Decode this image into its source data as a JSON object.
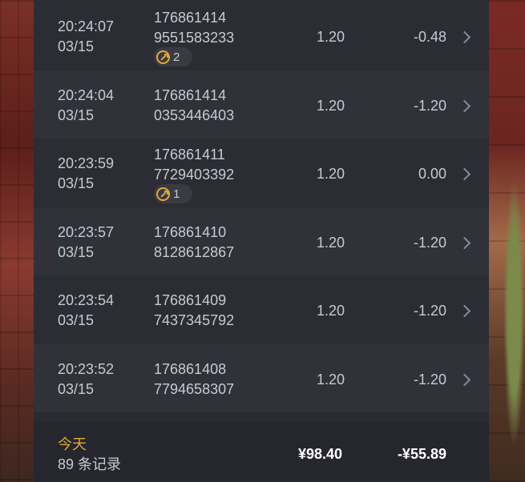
{
  "records": [
    {
      "time": "20:24:07",
      "date": "03/15",
      "order_line1": "176861414",
      "order_line2": "9551583233",
      "badge": "2",
      "amount": "1.20",
      "profit": "-0.48"
    },
    {
      "time": "20:24:04",
      "date": "03/15",
      "order_line1": "176861414",
      "order_line2": "0353446403",
      "badge": null,
      "amount": "1.20",
      "profit": "-1.20"
    },
    {
      "time": "20:23:59",
      "date": "03/15",
      "order_line1": "176861411",
      "order_line2": "7729403392",
      "badge": "1",
      "amount": "1.20",
      "profit": "0.00"
    },
    {
      "time": "20:23:57",
      "date": "03/15",
      "order_line1": "176861410",
      "order_line2": "8128612867",
      "badge": null,
      "amount": "1.20",
      "profit": "-1.20"
    },
    {
      "time": "20:23:54",
      "date": "03/15",
      "order_line1": "176861409",
      "order_line2": "7437345792",
      "badge": null,
      "amount": "1.20",
      "profit": "-1.20"
    },
    {
      "time": "20:23:52",
      "date": "03/15",
      "order_line1": "176861408",
      "order_line2": "7794658307",
      "badge": null,
      "amount": "1.20",
      "profit": "-1.20"
    }
  ],
  "summary": {
    "title": "今天",
    "count_label": "89 条记录",
    "total_amount": "¥98.40",
    "total_profit": "-¥55.89"
  },
  "colors": {
    "accent": "#e0a93a",
    "text": "#c9c9d2",
    "panel": "#2a2a33"
  },
  "icons": {
    "badge": "link-icon",
    "row_arrow": "chevron-right-icon"
  }
}
